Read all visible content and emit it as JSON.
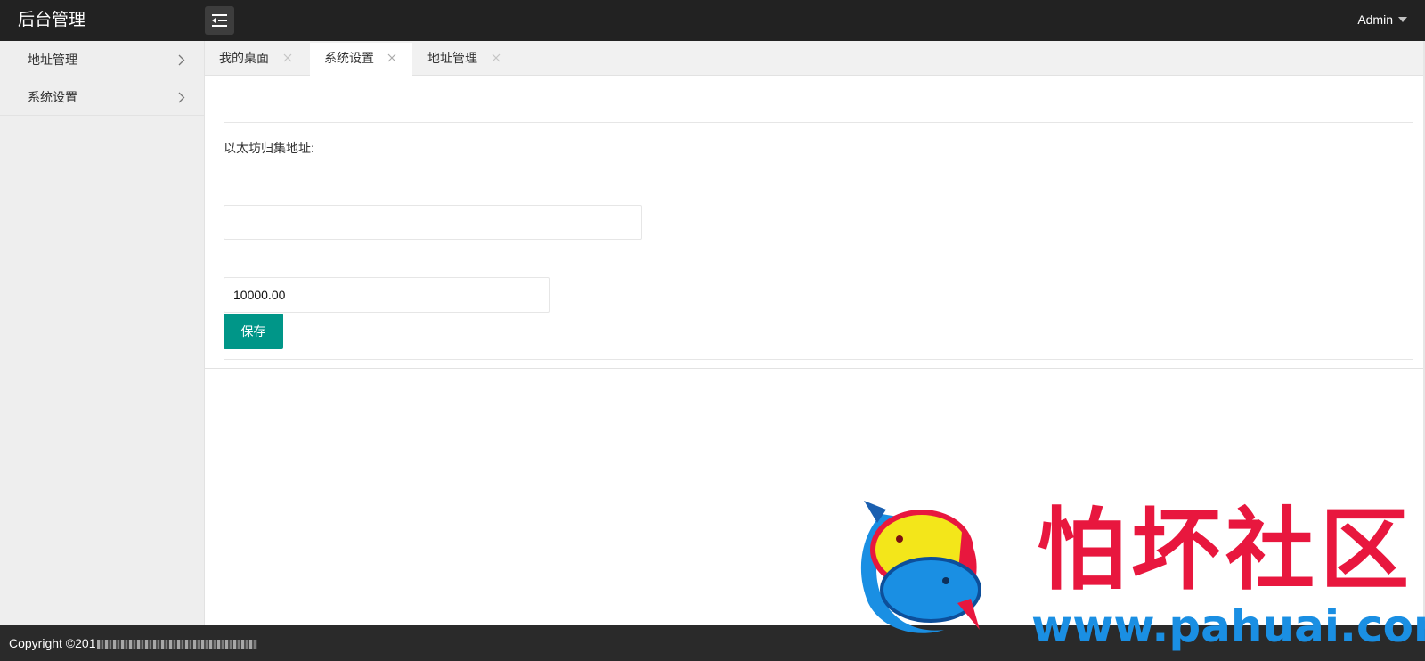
{
  "header": {
    "title": "后台管理",
    "user": "Admin"
  },
  "sidebar": {
    "items": [
      {
        "label": "地址管理"
      },
      {
        "label": "系统设置"
      }
    ]
  },
  "tabs": [
    {
      "label": "我的桌面",
      "active": false
    },
    {
      "label": "系统设置",
      "active": true
    },
    {
      "label": "地址管理",
      "active": false
    }
  ],
  "form": {
    "address_label": "以太坊归集地址:",
    "address_value": "",
    "amount_value": "10000.00",
    "save_label": "保存"
  },
  "footer": {
    "copyright": "Copyright ©201"
  },
  "watermark": {
    "title": "怕坏社区",
    "url": "www.pahuai.com"
  },
  "colors": {
    "header_bg": "#222222",
    "sidebar_bg": "#eeeeee",
    "accent": "#009688",
    "watermark_red": "#e8173e",
    "watermark_blue": "#1a8fe3"
  }
}
